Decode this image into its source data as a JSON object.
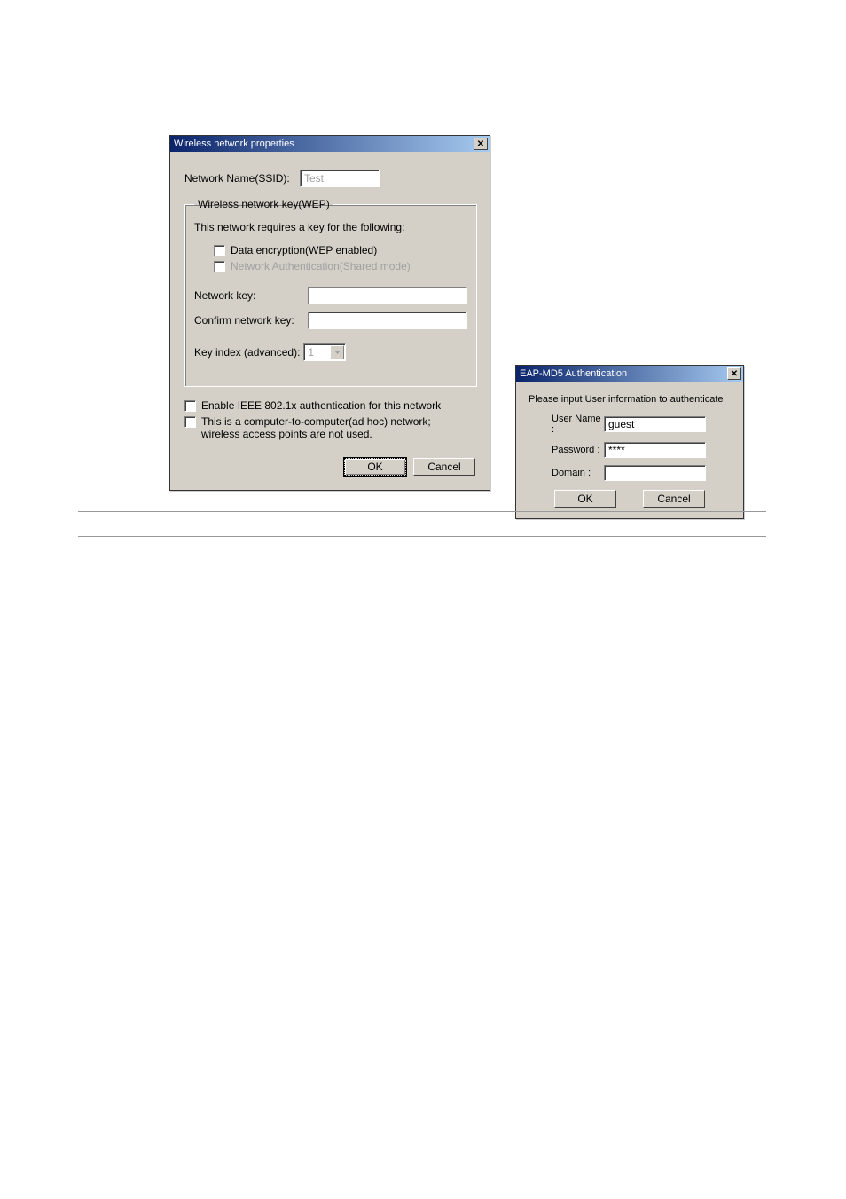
{
  "dialog1": {
    "title": "Wireless network properties",
    "close_glyph": "✕",
    "ssid_label": "Network Name(SSID):",
    "ssid_value": "Test",
    "wep": {
      "legend": "Wireless network key(WEP)",
      "requires": "This network requires a key for the following:",
      "data_encryption": "Data encryption(WEP enabled)",
      "network_auth": "Network Authentication(Shared mode)",
      "network_key_label": "Network key:",
      "confirm_key_label": "Confirm network key:",
      "key_index_label": "Key index (advanced):",
      "key_index_value": "1"
    },
    "enable_8021x": "Enable IEEE 802.1x authentication for this network",
    "adhoc": "This is a computer-to-computer(ad hoc) network; wireless access points are not used.",
    "ok": "OK",
    "cancel": "Cancel"
  },
  "dialog2": {
    "title": "EAP-MD5 Authentication",
    "close_glyph": "✕",
    "instruction": "Please input User information to authenticate",
    "user_label": "User Name :",
    "user_value": "guest",
    "password_label": "Password :",
    "password_value": "****",
    "domain_label": "Domain :",
    "domain_value": "",
    "ok": "OK",
    "cancel": "Cancel"
  }
}
